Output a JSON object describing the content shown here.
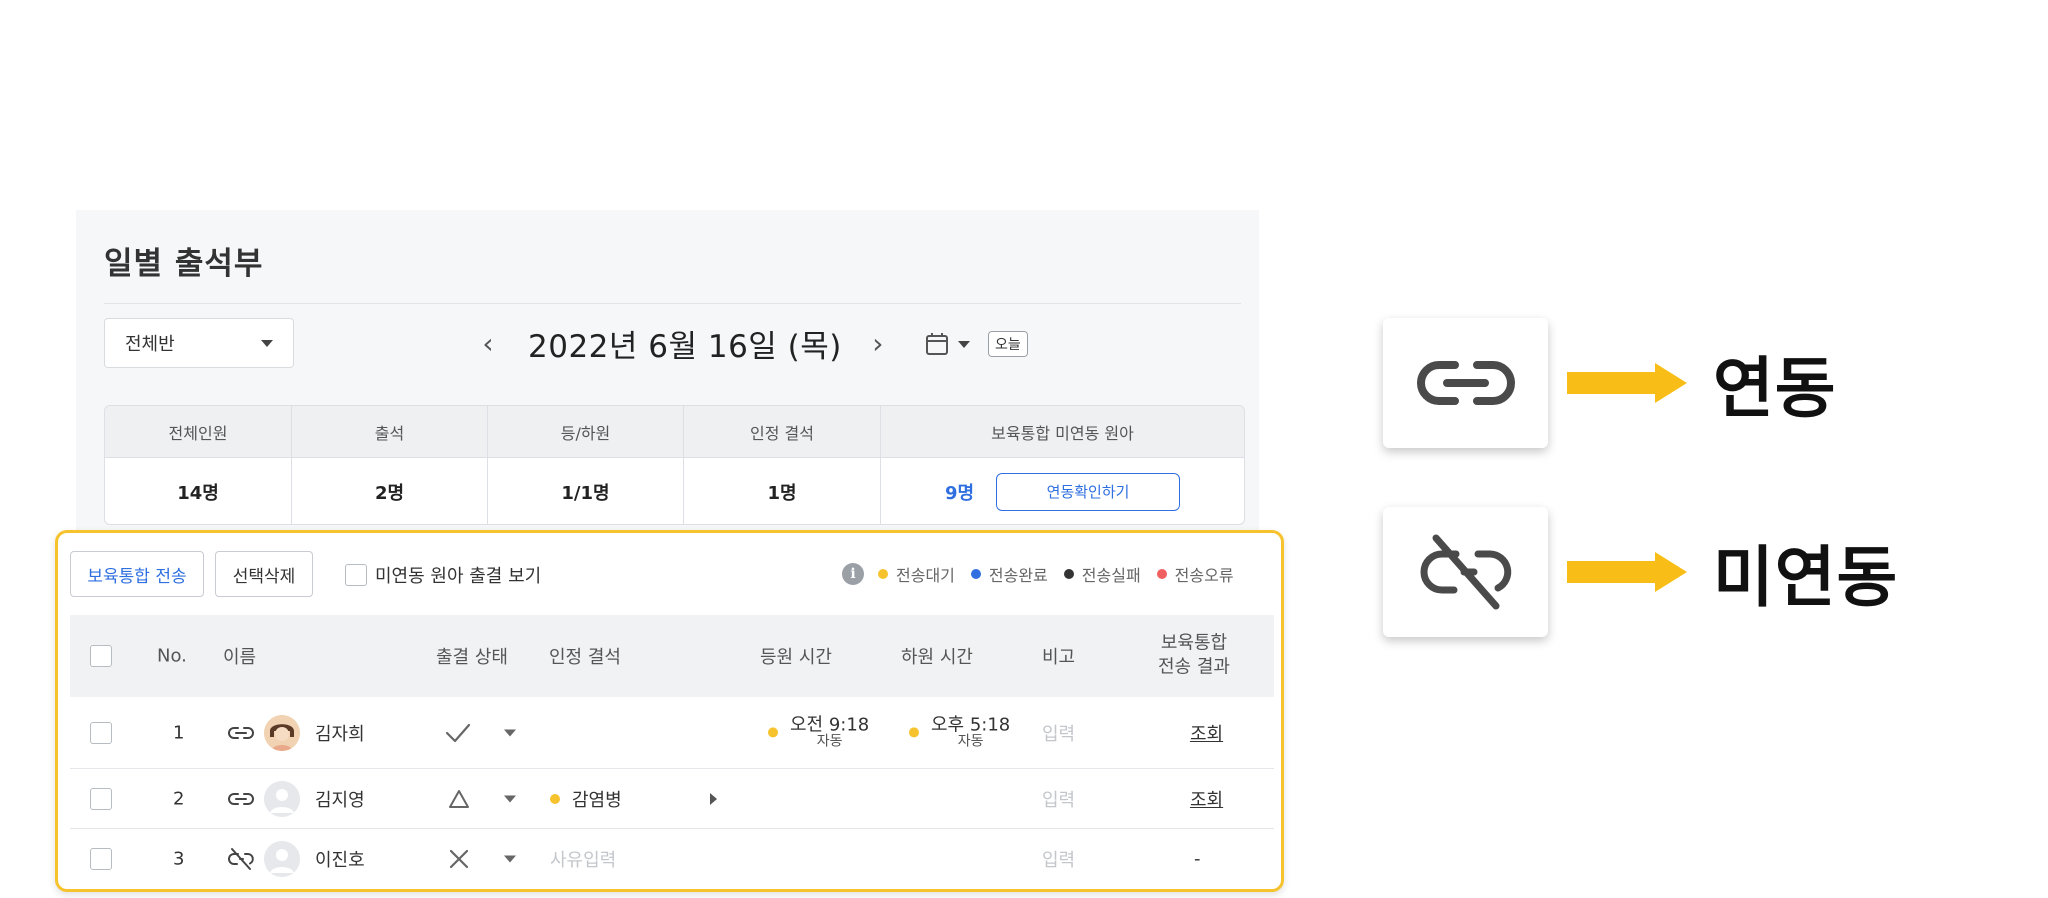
{
  "page": {
    "title": "일별 출석부",
    "class_select": "전체반",
    "date": "2022년 6월 16일 (목)",
    "today_btn": "오늘"
  },
  "summary": {
    "headers": [
      "전체인원",
      "출석",
      "등/하원",
      "인정 결석",
      "보육통합 미연동 원아"
    ],
    "values": [
      "14명",
      "2명",
      "1/1명",
      "1명",
      "9명"
    ],
    "confirm_button": "연동확인하기"
  },
  "toolbar": {
    "send_button": "보육통합 전송",
    "delete_button": "선택삭제",
    "unlinked_option": "미연동 원아 출결 보기"
  },
  "status_legend": [
    {
      "label": "전송대기",
      "color": "#f6c32f"
    },
    {
      "label": "전송완료",
      "color": "#2f6fe0"
    },
    {
      "label": "전송실패",
      "color": "#333333"
    },
    {
      "label": "전송오류",
      "color": "#f06060"
    }
  ],
  "table": {
    "headers": {
      "no": "No.",
      "name": "이름",
      "status": "출결 상태",
      "excused": "인정 결석",
      "in_time": "등원 시간",
      "out_time": "하원 시간",
      "note": "비고",
      "result_line1": "보육통합",
      "result_line2": "전송 결과"
    },
    "rows": [
      {
        "no": "1",
        "link": "link-icon",
        "name": "김자희",
        "status_icon": "check-icon",
        "excused": "",
        "in_time": "오전 9:18",
        "in_sub": "자동",
        "out_time": "오후 5:18",
        "out_sub": "자동",
        "note": "입력",
        "result": "조회"
      },
      {
        "no": "2",
        "link": "link-icon",
        "name": "김지영",
        "status_icon": "triangle-icon",
        "excused": "감염병",
        "in_time": "",
        "out_time": "",
        "note": "입력",
        "result": "조회"
      },
      {
        "no": "3",
        "link": "unlink-icon",
        "name": "이진호",
        "status_icon": "x-icon",
        "excused": "사유입력",
        "in_time": "",
        "out_time": "",
        "note": "입력",
        "result": "-"
      }
    ]
  },
  "legend_right": {
    "linked": "연동",
    "unlinked": "미연동",
    "accent": "#f8be17"
  }
}
